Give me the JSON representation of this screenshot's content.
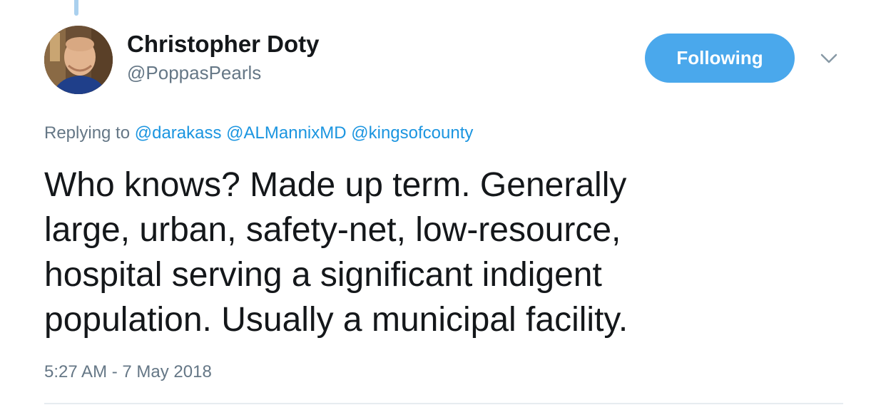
{
  "tweet": {
    "author": {
      "display_name": "Christopher Doty",
      "handle": "@PoppasPearls"
    },
    "follow_button_label": "Following",
    "replying_to_prefix": "Replying to",
    "mentions": [
      "@darakass",
      "@ALMannixMD",
      "@kingsofcounty"
    ],
    "text": "Who knows?   Made up term.  Generally\nlarge, urban, safety-net, low-resource,\nhospital serving a significant indigent\npopulation.   Usually a municipal facility.",
    "timestamp": "5:27 AM - 7 May 2018"
  },
  "colors": {
    "accent": "#4aa8ec",
    "link": "#1b95e0",
    "muted": "#657786",
    "text": "#14171a",
    "thread_line": "#aad0ee",
    "divider": "#e6ecf0"
  },
  "icons": {
    "caret": "chevron-down-icon"
  }
}
